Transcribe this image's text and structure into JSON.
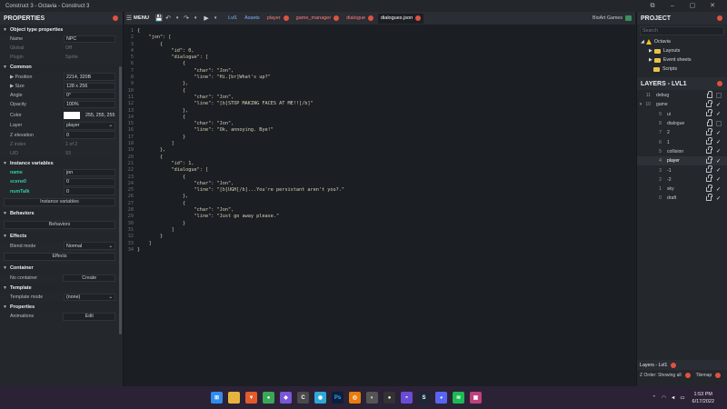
{
  "window": {
    "title": "Construct 3 - Octavia - Construct 3"
  },
  "properties": {
    "title": "PROPERTIES",
    "object_type_section": "Object type properties",
    "name_label": "Name",
    "name_value": "NPC",
    "global_label": "Global",
    "global_value": "Off",
    "plugin_label": "Plugin",
    "plugin_value": "Sprite",
    "common_section": "Common",
    "position_label": "Position",
    "position_value": "2214, 320B",
    "size_label": "Size",
    "size_value": "128 x 256",
    "angle_label": "Angle",
    "angle_value": "0°",
    "opacity_label": "Opacity",
    "opacity_value": "100%",
    "color_label": "Color",
    "color_value": "255, 255, 255",
    "color_swatch": "#ffffff",
    "layer_label": "Layer",
    "layer_value": "player",
    "zelev_label": "Z elevation",
    "zelev_value": "0",
    "zindex_label": "Z index",
    "zindex_value": "1 of 2",
    "uid_label": "UID",
    "uid_value": "93",
    "instance_vars_section": "Instance variables",
    "var1_name": "name",
    "var1_value": "jon",
    "var2_name": "scene0",
    "var2_value": "0",
    "var3_name": "numTalk",
    "var3_value": "0",
    "instance_vars_button": "Instance variables",
    "behaviors_section": "Behaviors",
    "behaviors_button": "Behaviors",
    "effects_section": "Effects",
    "blend_label": "Blend mode",
    "blend_value": "Normal",
    "effects_button": "Effects",
    "container_section": "Container",
    "no_container": "No container",
    "create_button": "Create",
    "template_section": "Template",
    "template_mode_label": "Template mode",
    "template_mode_value": "(none)",
    "properties_section": "Properties",
    "animations_label": "Animations",
    "edit_button": "Edit"
  },
  "toolbar": {
    "menu": "MENU",
    "tabs": [
      {
        "label": "Lvl1",
        "color": "#7fb6ff"
      },
      {
        "label": "Assets",
        "color": "#7fb6ff"
      },
      {
        "label": "player",
        "color": "#ff7d7d"
      },
      {
        "label": "game_manager",
        "color": "#ff7d7d"
      },
      {
        "label": "dialogue",
        "color": "#ff7d7d"
      },
      {
        "label": "dialogues.json",
        "color": "#ffffff"
      }
    ],
    "account": "BioArt Games"
  },
  "editor": {
    "lines": [
      "{",
      "    \"jon\": [",
      "        {",
      "            \"id\": 0,",
      "            \"dialogue\": [",
      "                {",
      "                    \"char\": \"Jon\",",
      "                    \"line\": \"Hi.[br]What's up?\"",
      "                },",
      "                {",
      "                    \"char\": \"Jon\",",
      "                    \"line\": \"[b]STOP MAKING FACES AT ME!![/b]\"",
      "                },",
      "                {",
      "                    \"char\": \"Jon\",",
      "                    \"line\": \"Ok, annoying. Bye!\"",
      "                }",
      "            ]",
      "        },",
      "        {",
      "            \"id\": 1,",
      "            \"dialogue\": [",
      "                {",
      "                    \"char\": \"Jon\",",
      "                    \"line\": \"[b]UGH[/b]...You're persistant aren't you?.\"",
      "                },",
      "                {",
      "                    \"char\": \"Jon\",",
      "                    \"line\": \"Just go away please.\"",
      "                }",
      "            ]",
      "        }",
      "    ]",
      "}"
    ]
  },
  "project": {
    "title": "PROJECT",
    "search_placeholder": "Search",
    "root": "Octavia",
    "items": [
      "Layouts",
      "Event sheets",
      "Scripts"
    ]
  },
  "layers": {
    "title": "LAYERS - LVL1",
    "items": [
      {
        "num": "11",
        "name": "debug",
        "indent": 0,
        "locked": true,
        "visible": false,
        "selected": false,
        "expander": false
      },
      {
        "num": "10",
        "name": "game",
        "indent": 0,
        "locked": true,
        "visible": true,
        "selected": false,
        "expander": true
      },
      {
        "num": "9",
        "name": "ui",
        "indent": 1,
        "locked": true,
        "visible": true,
        "selected": false,
        "expander": false
      },
      {
        "num": "8",
        "name": "dialogue",
        "indent": 1,
        "locked": true,
        "visible": false,
        "selected": false,
        "expander": false
      },
      {
        "num": "7",
        "name": "2",
        "indent": 1,
        "locked": true,
        "visible": true,
        "selected": false,
        "expander": false
      },
      {
        "num": "6",
        "name": "1",
        "indent": 1,
        "locked": true,
        "visible": true,
        "selected": false,
        "expander": false
      },
      {
        "num": "5",
        "name": "collision",
        "indent": 1,
        "locked": true,
        "visible": true,
        "selected": false,
        "expander": false
      },
      {
        "num": "4",
        "name": "player",
        "indent": 1,
        "locked": true,
        "visible": true,
        "selected": true,
        "expander": false
      },
      {
        "num": "3",
        "name": "-1",
        "indent": 1,
        "locked": true,
        "visible": true,
        "selected": false,
        "expander": false
      },
      {
        "num": "2",
        "name": "-2",
        "indent": 1,
        "locked": true,
        "visible": true,
        "selected": false,
        "expander": false
      },
      {
        "num": "1",
        "name": "sky",
        "indent": 1,
        "locked": true,
        "visible": true,
        "selected": false,
        "expander": false
      },
      {
        "num": "0",
        "name": "draft",
        "indent": 1,
        "locked": true,
        "visible": true,
        "selected": false,
        "expander": false
      }
    ],
    "bottom_tab": "Layers - Lvl1",
    "zorder_label": "Z Order: Showing all",
    "tilemap_label": "Tilemap"
  },
  "taskbar": {
    "time": "1:53 PM",
    "date": "6/17/2022",
    "accent": "#e0523f"
  }
}
